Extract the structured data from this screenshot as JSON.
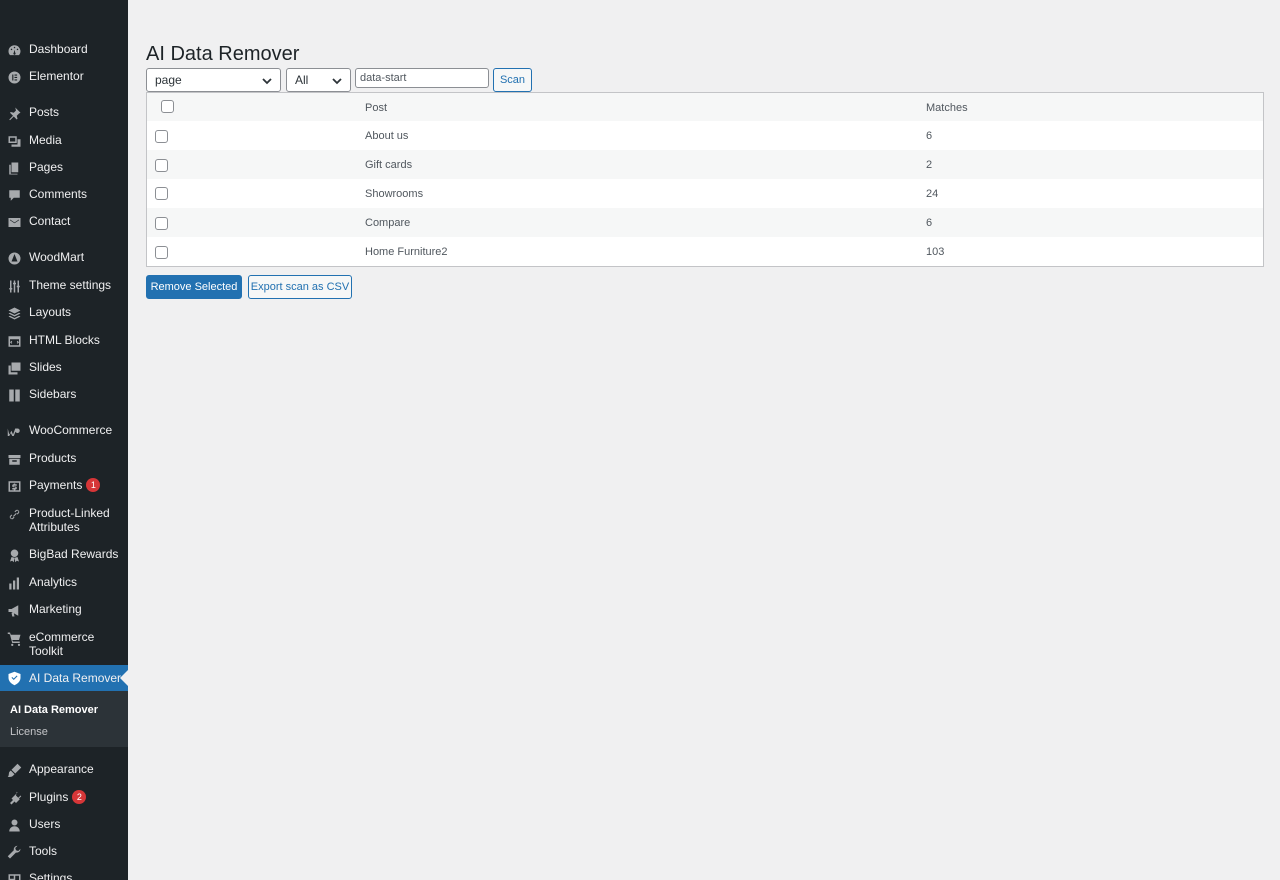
{
  "sidebar": {
    "items": [
      {
        "label": "Dashboard",
        "icon": "dashboard-icon"
      },
      {
        "label": "Elementor",
        "icon": "elementor-icon"
      },
      {
        "label": "Posts",
        "icon": "pin-icon"
      },
      {
        "label": "Media",
        "icon": "media-icon"
      },
      {
        "label": "Pages",
        "icon": "pages-icon"
      },
      {
        "label": "Comments",
        "icon": "comment-icon"
      },
      {
        "label": "Contact",
        "icon": "mail-icon"
      },
      {
        "label": "WoodMart",
        "icon": "woodmart-icon"
      },
      {
        "label": "Theme settings",
        "icon": "sliders-icon"
      },
      {
        "label": "Layouts",
        "icon": "layers-icon"
      },
      {
        "label": "HTML Blocks",
        "icon": "html-icon"
      },
      {
        "label": "Slides",
        "icon": "slides-icon"
      },
      {
        "label": "Sidebars",
        "icon": "sidebar-icon"
      },
      {
        "label": "WooCommerce",
        "icon": "woo-icon"
      },
      {
        "label": "Products",
        "icon": "archive-icon"
      },
      {
        "label": "Payments",
        "icon": "dollar-icon",
        "badge": "1"
      },
      {
        "label": "Product-Linked Attributes",
        "icon": "link-icon"
      },
      {
        "label": "BigBad Rewards",
        "icon": "award-icon"
      },
      {
        "label": "Analytics",
        "icon": "bar-chart-icon"
      },
      {
        "label": "Marketing",
        "icon": "megaphone-icon"
      },
      {
        "label": "eCommerce Toolkit",
        "icon": "cart-icon"
      },
      {
        "label": "AI Data Remover",
        "icon": "shield-icon"
      },
      {
        "label": "Appearance",
        "icon": "brush-icon"
      },
      {
        "label": "Plugins",
        "icon": "plugin-icon",
        "badge": "2"
      },
      {
        "label": "Users",
        "icon": "user-icon"
      },
      {
        "label": "Tools",
        "icon": "wrench-icon"
      },
      {
        "label": "Settings",
        "icon": "settings-icon"
      }
    ],
    "submenu": [
      {
        "label": "AI Data Remover"
      },
      {
        "label": "License"
      }
    ]
  },
  "main": {
    "title": "AI Data Remover",
    "post_type_select": "page",
    "status_select": "All",
    "search_value": "data-start",
    "scan_label": "Scan",
    "table": {
      "headers": {
        "post": "Post",
        "matches": "Matches"
      },
      "rows": [
        {
          "post": "About us",
          "matches": "6"
        },
        {
          "post": "Gift cards",
          "matches": "2"
        },
        {
          "post": "Showrooms",
          "matches": "24"
        },
        {
          "post": "Compare",
          "matches": "6"
        },
        {
          "post": "Home Furniture2",
          "matches": "103"
        }
      ]
    },
    "remove_label": "Remove Selected",
    "export_label": "Export scan as CSV"
  }
}
